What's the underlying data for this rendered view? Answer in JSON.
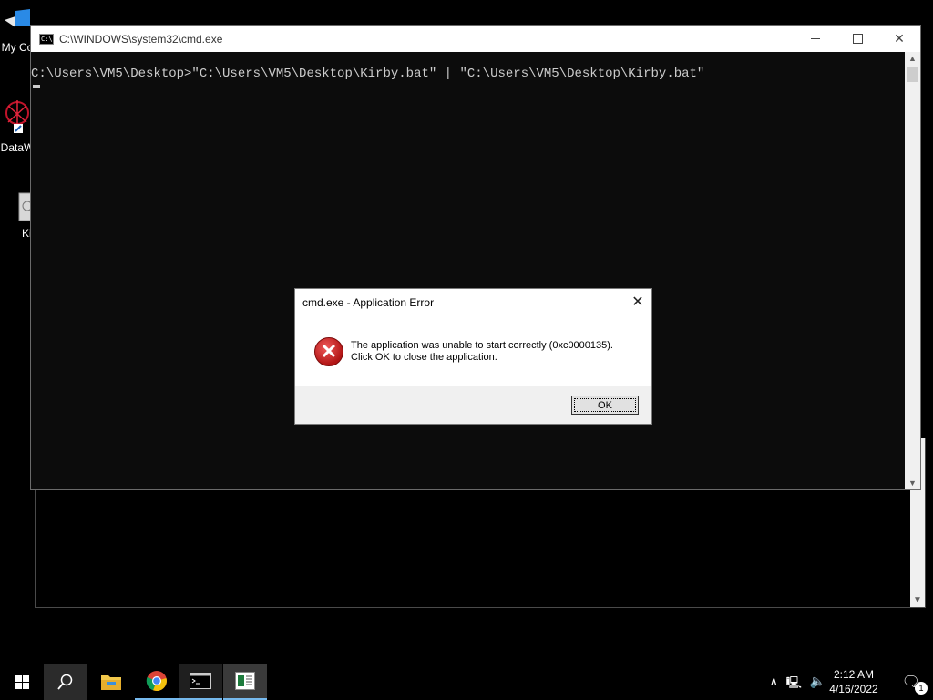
{
  "desktop": {
    "icons": [
      {
        "label": "My Co",
        "icon": "monitor-icon"
      },
      {
        "label": "DataW",
        "icon": "datawrangler-icon"
      },
      {
        "label": "Ki",
        "icon": "file-icon"
      }
    ]
  },
  "cmd_window": {
    "title": "C:\\WINDOWS\\system32\\cmd.exe",
    "console_line": "C:\\Users\\VM5\\Desktop>\"C:\\Users\\VM5\\Desktop\\Kirby.bat\" | \"C:\\Users\\VM5\\Desktop\\Kirby.bat\"",
    "background": "#0c0c0c",
    "text_color": "#cccccc"
  },
  "error_dialog": {
    "title": "cmd.exe - Application Error",
    "message_line1": "The application was unable to start correctly (0xc0000135).",
    "message_line2": "Click OK to close the application.",
    "ok_label": "OK",
    "icon": "error-x-icon"
  },
  "taskbar": {
    "items": [
      "start-icon",
      "search-icon",
      "file-explorer-icon",
      "chrome-icon",
      "cmd-icon",
      "app-icon"
    ],
    "time": "2:12 AM",
    "date": "4/16/2022",
    "notification_count": "1"
  }
}
